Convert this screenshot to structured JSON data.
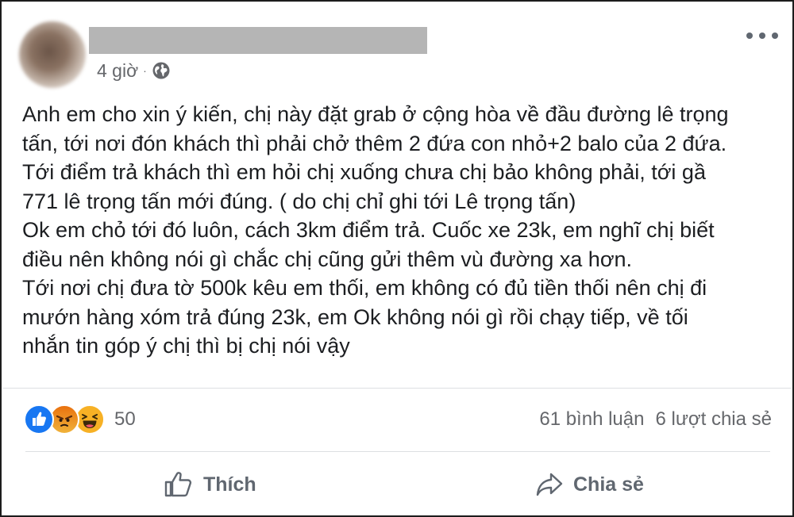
{
  "post": {
    "time": "4 giờ",
    "separator": "·",
    "lines": [
      "Anh em cho xin ý kiến, chị này đặt grab ở cộng hòa về đầu đường lê trọng",
      "tấn, tới nơi đón khách thì phải chở thêm 2 đứa con nhỏ+2 balo của 2 đứa.",
      "Tới điểm trả khách thì em hỏi chị xuống chưa chị bảo không phải, tới gầ",
      "771 lê trọng tấn mới đúng. ( do chị chỉ ghi tới Lê trọng tấn)",
      "Ok em chỏ tới đó luôn, cách 3km điểm trả. Cuốc xe 23k, em nghĩ chị biết",
      "điều nên không nói gì chắc chị cũng gửi thêm vù đường xa hơn.",
      "Tới nơi chị đưa tờ 500k kêu em thối, em không có đủ tiền thối nên chị đi",
      "mướn hàng xóm trả đúng 23k, em Ok không nói gì rồi chạy tiếp, về tối",
      "nhắn tin góp ý chị thì bị chị nói vậy"
    ]
  },
  "engagement": {
    "reaction_icons": [
      "like-icon",
      "angry-icon",
      "haha-icon"
    ],
    "reaction_count": "50",
    "comments": "61 bình luận",
    "shares": "6 lượt chia sẻ"
  },
  "actions": {
    "like_label": "Thích",
    "share_label": "Chia sẻ"
  },
  "colors": {
    "like_blue": "#1877f2",
    "secondary_text": "#65676b",
    "redaction_gray": "#b5b5b5"
  }
}
